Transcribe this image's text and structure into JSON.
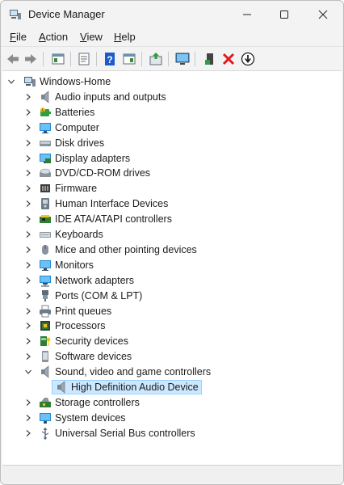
{
  "window": {
    "title": "Device Manager"
  },
  "menu": [
    {
      "label": "File",
      "access": "F",
      "rest": "ile"
    },
    {
      "label": "Action",
      "access": "A",
      "rest": "ction"
    },
    {
      "label": "View",
      "access": "V",
      "rest": "iew"
    },
    {
      "label": "Help",
      "access": "H",
      "rest": "elp"
    }
  ],
  "tree": {
    "root": "Windows-Home",
    "categories": [
      {
        "label": "Audio inputs and outputs",
        "icon": "speaker-icon"
      },
      {
        "label": "Batteries",
        "icon": "battery-icon"
      },
      {
        "label": "Computer",
        "icon": "computer-icon"
      },
      {
        "label": "Disk drives",
        "icon": "disk-drive-icon"
      },
      {
        "label": "Display adapters",
        "icon": "display-adapter-icon"
      },
      {
        "label": "DVD/CD-ROM drives",
        "icon": "dvd-drive-icon"
      },
      {
        "label": "Firmware",
        "icon": "firmware-icon"
      },
      {
        "label": "Human Interface Devices",
        "icon": "hid-icon"
      },
      {
        "label": "IDE ATA/ATAPI controllers",
        "icon": "ide-controller-icon"
      },
      {
        "label": "Keyboards",
        "icon": "keyboard-icon"
      },
      {
        "label": "Mice and other pointing devices",
        "icon": "mouse-icon"
      },
      {
        "label": "Monitors",
        "icon": "monitor-icon"
      },
      {
        "label": "Network adapters",
        "icon": "network-adapter-icon"
      },
      {
        "label": "Ports (COM & LPT)",
        "icon": "port-icon"
      },
      {
        "label": "Print queues",
        "icon": "printer-icon"
      },
      {
        "label": "Processors",
        "icon": "processor-icon"
      },
      {
        "label": "Security devices",
        "icon": "security-device-icon"
      },
      {
        "label": "Software devices",
        "icon": "software-device-icon"
      },
      {
        "label": "Sound, video and game controllers",
        "icon": "speaker-icon",
        "expanded": true,
        "children": [
          {
            "label": "High Definition Audio Device",
            "icon": "speaker-icon",
            "selected": true
          }
        ]
      },
      {
        "label": "Storage controllers",
        "icon": "storage-controller-icon"
      },
      {
        "label": "System devices",
        "icon": "system-device-icon"
      },
      {
        "label": "Universal Serial Bus controllers",
        "icon": "usb-icon"
      }
    ]
  },
  "colors": {
    "selection": "#cce8ff",
    "selection_border": "#99d1ff",
    "accent_blue": "#1e88d8"
  }
}
